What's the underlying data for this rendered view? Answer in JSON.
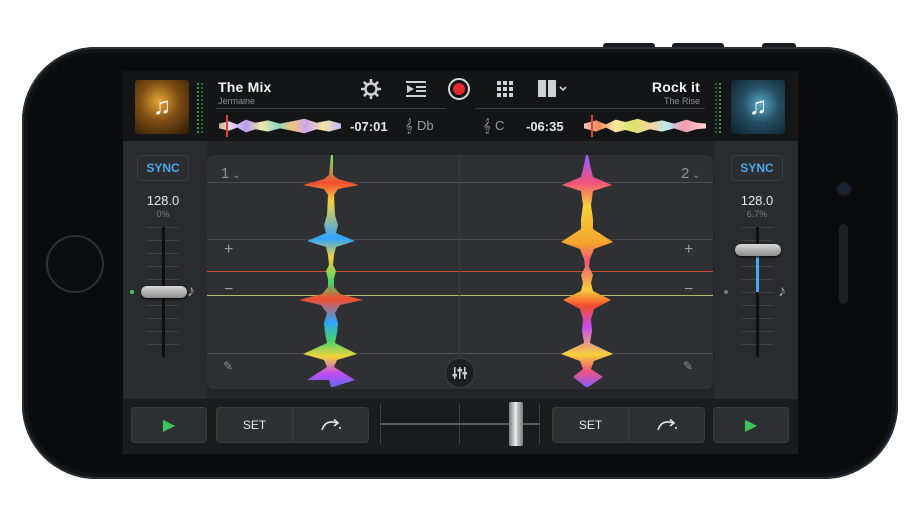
{
  "deck_left": {
    "album_icon": "music-note-icon",
    "title": "The Mix",
    "artist": "Jermaine",
    "time_remaining": "-07:01",
    "key_icon": "treble-clef-icon",
    "key": "Db",
    "deck_number": "1",
    "sync_label": "SYNC",
    "bpm": "128.0",
    "pitch": "0%",
    "pitch_fraction": 0.5
  },
  "deck_right": {
    "album_icon": "music-note-icon",
    "title": "Rock it",
    "artist": "The Rise",
    "time_remaining": "-06:35",
    "key_icon": "treble-clef-icon",
    "key": "C",
    "deck_number": "2",
    "sync_label": "SYNC",
    "bpm": "128.0",
    "pitch": "6.7%",
    "pitch_fraction": 0.18
  },
  "toolbar": {
    "settings_icon": "gear-icon",
    "playlist_icon": "queue-icon",
    "record_icon": "record-icon",
    "pads_icon": "grid-icon",
    "layout_icon": "layout-icon"
  },
  "center": {
    "zoom_in": "+",
    "zoom_out": "−",
    "mixer_icon": "mixer-icon",
    "edit_icon": "pencil-icon"
  },
  "transport": {
    "left_play": "▶",
    "left_set": "SET",
    "left_jump_icon": "jump-icon",
    "right_set": "SET",
    "right_jump_icon": "jump-icon",
    "right_play": "▶",
    "crossfader_position": 0.85
  },
  "colors": {
    "accent_blue": "#4aa9ea",
    "play_green": "#3cc55b",
    "record_red": "#e2292c",
    "playhead_red": "#c94b3a"
  }
}
